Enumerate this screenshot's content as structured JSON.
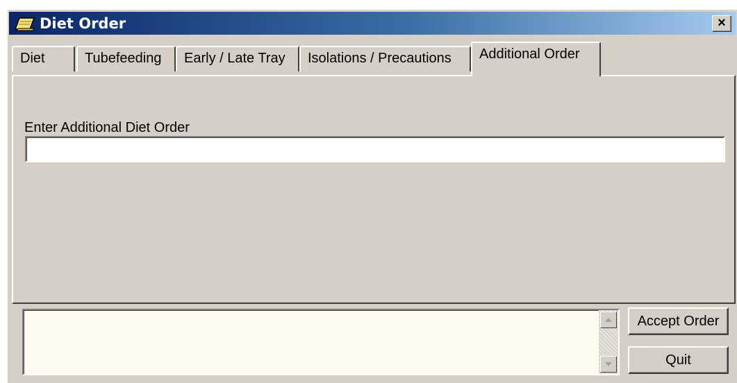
{
  "window": {
    "title": "Diet Order",
    "close_label": "×"
  },
  "tabs": [
    {
      "label": "Diet",
      "active": false
    },
    {
      "label": "Tubefeeding",
      "active": false
    },
    {
      "label": "Early / Late Tray",
      "active": false
    },
    {
      "label": "Isolations / Precautions",
      "active": false
    },
    {
      "label": "Additional Order",
      "active": true
    }
  ],
  "additional_order": {
    "label": "Enter Additional Diet Order",
    "value": "",
    "placeholder": ""
  },
  "memo": {
    "value": ""
  },
  "buttons": {
    "accept": "Accept Order",
    "quit": "Quit"
  },
  "icons": {
    "app": "notepad-pencil-icon",
    "scroll_up": "arrow-up-icon",
    "scroll_down": "arrow-down-icon"
  }
}
